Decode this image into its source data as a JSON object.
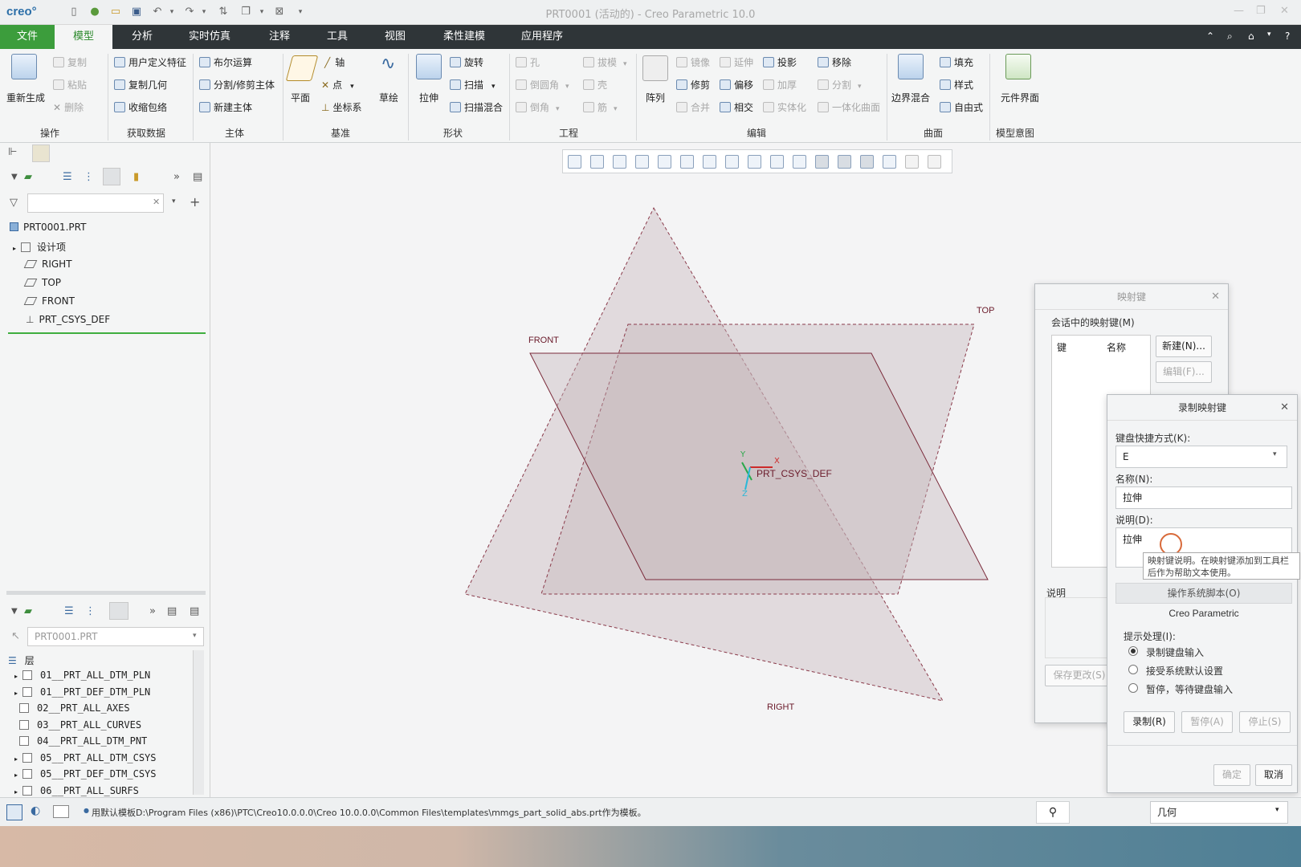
{
  "app": {
    "logo": "creo°",
    "title": "PRT0001 (活动的) - Creo Parametric 10.0"
  },
  "tabs": [
    "文件",
    "模型",
    "分析",
    "实时仿真",
    "注释",
    "工具",
    "视图",
    "柔性建模",
    "应用程序"
  ],
  "ribbon": {
    "regen": "重新生成",
    "op": {
      "copy": "复制",
      "paste": "粘贴",
      "delete": "删除",
      "group": "操作"
    },
    "getdata": {
      "udf": "用户定义特征",
      "copygeom": "复制几何",
      "shrinkwrap": "收缩包络",
      "group": "获取数据"
    },
    "body": {
      "bool": "布尔运算",
      "split": "分割/修剪主体",
      "newbody": "新建主体",
      "group": "主体"
    },
    "datum": {
      "plane": "平面",
      "axis": "轴",
      "point": "点",
      "csys": "坐标系",
      "sketch": "草绘",
      "group": "基准"
    },
    "shape": {
      "extrude": "拉伸",
      "revolve": "旋转",
      "sweep": "扫描",
      "sweepblend": "扫描混合",
      "group": "形状"
    },
    "eng": {
      "hole": "孔",
      "round": "倒圆角",
      "chamfer": "倒角",
      "draft": "拔模",
      "shell": "壳",
      "rib": "筋",
      "group": "工程"
    },
    "edit": {
      "pattern": "阵列",
      "mirror": "镜像",
      "extend": "延伸",
      "project": "投影",
      "trim": "修剪",
      "offset": "偏移",
      "thicken": "加厚",
      "merge": "合并",
      "intersect": "相交",
      "solidify": "实体化",
      "remove": "移除",
      "split": "分割",
      "unify": "一体化曲面",
      "group": "编辑"
    },
    "surf": {
      "boundary": "边界混合",
      "fill": "填充",
      "style": "样式",
      "freestyle": "自由式",
      "group": "曲面"
    },
    "intent": {
      "compif": "元件界面",
      "group": "模型意图"
    }
  },
  "tree": {
    "root": "PRT0001.PRT",
    "items": [
      "设计项",
      "RIGHT",
      "TOP",
      "FRONT",
      "PRT_CSYS_DEF"
    ]
  },
  "layers": {
    "model": "PRT0001.PRT",
    "header": "层",
    "items": [
      "01__PRT_ALL_DTM_PLN",
      "01__PRT_DEF_DTM_PLN",
      "02__PRT_ALL_AXES",
      "03__PRT_ALL_CURVES",
      "04__PRT_ALL_DTM_PNT",
      "05__PRT_ALL_DTM_CSYS",
      "05__PRT_DEF_DTM_CSYS",
      "06__PRT_ALL_SURFS"
    ]
  },
  "graphics": {
    "front": "FRONT",
    "top": "TOP",
    "right": "RIGHT",
    "csys": "PRT_CSYS_DEF",
    "x": "X",
    "y": "Y",
    "z": "Z"
  },
  "mapkeys": {
    "title": "映射键",
    "session": "会话中的映射键(M)",
    "col_key": "键",
    "col_name": "名称",
    "new": "新建(N)...",
    "edit": "编辑(F)...",
    "desc": "说明",
    "save": "保存更改(S)"
  },
  "record": {
    "title": "录制映射键",
    "key_label": "键盘快捷方式(K):",
    "key_value": "E",
    "name_label": "名称(N):",
    "name_value": "拉伸",
    "desc_label": "说明(D):",
    "desc_value": "拉伸",
    "tooltip": "映射键说明。在映射键添加到工具栏后作为帮助文本使用。",
    "os_script": "操作系统脚本(O)",
    "creo": "Creo Parametric",
    "prompt_label": "提示处理(I):",
    "opt1": "录制键盘输入",
    "opt2": "接受系统默认设置",
    "opt3": "暂停，等待键盘输入",
    "rec": "录制(R)",
    "pause": "暂停(A)",
    "stop": "停止(S)",
    "ok": "确定",
    "cancel": "取消"
  },
  "status": {
    "message": "用默认模板D:\\Program Files (x86)\\PTC\\Creo10.0.0.0\\Creo 10.0.0.0\\Common Files\\templates\\mmgs_part_solid_abs.prt作为模板。",
    "filter": "几何"
  }
}
